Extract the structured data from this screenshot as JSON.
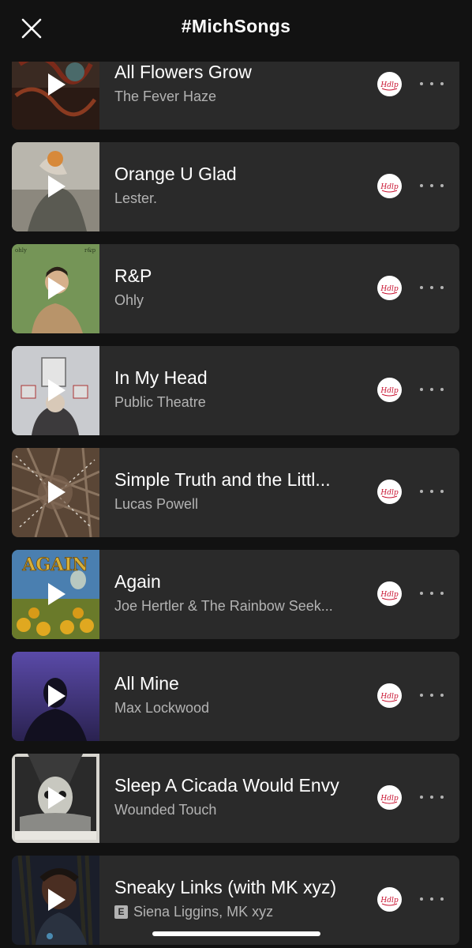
{
  "header": {
    "title": "#MichSongs",
    "close_icon": "close-icon"
  },
  "tracks": [
    {
      "title": "All Flowers Grow",
      "artist": "The Fever Haze",
      "explicit": false
    },
    {
      "title": "Orange U Glad",
      "artist": "Lester.",
      "explicit": false
    },
    {
      "title": "R&P",
      "artist": "Ohly",
      "explicit": false,
      "art_text_left": "ohly",
      "art_text_right": "r&p"
    },
    {
      "title": "In My Head",
      "artist": "Public Theatre",
      "explicit": false
    },
    {
      "title": "Simple Truth and the Littl...",
      "artist": "Lucas Powell",
      "explicit": false
    },
    {
      "title": "Again",
      "artist": "Joe Hertler & The Rainbow Seek...",
      "explicit": false,
      "art_text": "AGAIN"
    },
    {
      "title": "All Mine",
      "artist": "Max Lockwood",
      "explicit": false
    },
    {
      "title": "Sleep A Cicada Would Envy",
      "artist": "Wounded Touch",
      "explicit": false
    },
    {
      "title": "Sneaky Links (with MK xyz)",
      "artist": "Siena Liggins, MK xyz",
      "explicit": true,
      "explicit_label": "E"
    }
  ],
  "colors": {
    "background": "#121212",
    "card": "#2a2a2a",
    "secondary_text": "#b3b3b3",
    "badge_accent": "#c8102e"
  },
  "icons": [
    "close-icon",
    "play-icon",
    "station-badge-icon",
    "more-options-icon"
  ]
}
